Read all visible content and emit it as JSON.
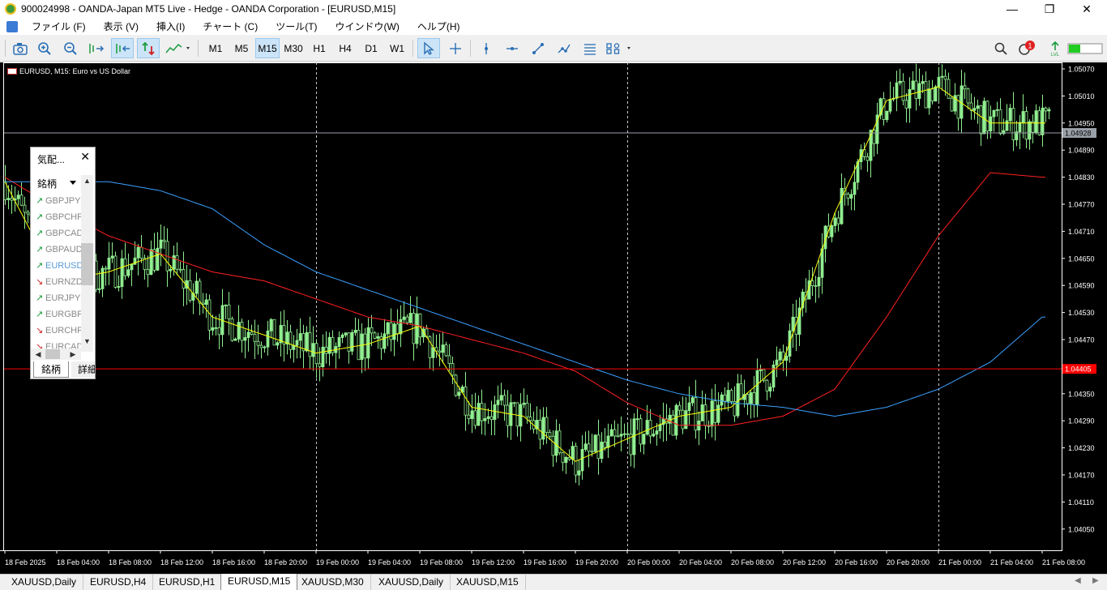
{
  "window": {
    "title": "900024998 - OANDA-Japan MT5 Live - Hedge - OANDA Corporation - [EURUSD,M15]",
    "controls": {
      "minimize": "—",
      "maximize": "❐",
      "close": "✕"
    }
  },
  "menu": [
    "ファイル (F)",
    "表示 (V)",
    "挿入(I)",
    "チャート (C)",
    "ツール(T)",
    "ウインドウ(W)",
    "ヘルプ(H)"
  ],
  "toolbar": {
    "timeframes": [
      "M1",
      "M5",
      "M15",
      "M30",
      "H1",
      "H4",
      "D1",
      "W1"
    ],
    "active_timeframe": "M15",
    "notification_count": "1"
  },
  "chart": {
    "label": "EURUSD, M15:  Euro vs US Dollar",
    "price_labels": [
      "1.05070",
      "1.05010",
      "1.04950",
      "1.04890",
      "1.04830",
      "1.04770",
      "1.04710",
      "1.04650",
      "1.04590",
      "1.04530",
      "1.04470",
      "1.04350",
      "1.04290",
      "1.04230",
      "1.04170",
      "1.04110",
      "1.04050"
    ],
    "bid_price": "1.04928",
    "red_line_price": "1.04405",
    "time_labels": [
      "18 Feb 2025",
      "18 Feb 04:00",
      "18 Feb 08:00",
      "18 Feb 12:00",
      "18 Feb 16:00",
      "18 Feb 20:00",
      "19 Feb 00:00",
      "19 Feb 04:00",
      "19 Feb 08:00",
      "19 Feb 12:00",
      "19 Feb 16:00",
      "19 Feb 20:00",
      "20 Feb 00:00",
      "20 Feb 04:00",
      "20 Feb 08:00",
      "20 Feb 12:00",
      "20 Feb 16:00",
      "20 Feb 20:00",
      "21 Feb 00:00",
      "21 Feb 04:00",
      "21 Feb 08:00"
    ],
    "colors": {
      "background": "#000000",
      "candle": "#90ee90",
      "ma_fast": "#ffff00",
      "ma_mid": "#ff2020",
      "ma_slow": "#3aa0ff",
      "price_line": "#9aa0a8",
      "red_line": "#ff0000"
    }
  },
  "chart_data": {
    "type": "line",
    "symbol": "EURUSD",
    "timeframe": "M15",
    "x": [
      "18 Feb 2025",
      "18 Feb 04:00",
      "18 Feb 08:00",
      "18 Feb 12:00",
      "18 Feb 16:00",
      "18 Feb 20:00",
      "19 Feb 00:00",
      "19 Feb 04:00",
      "19 Feb 08:00",
      "19 Feb 12:00",
      "19 Feb 16:00",
      "19 Feb 20:00",
      "20 Feb 00:00",
      "20 Feb 04:00",
      "20 Feb 08:00",
      "20 Feb 12:00",
      "20 Feb 16:00",
      "20 Feb 20:00",
      "21 Feb 00:00",
      "21 Feb 04:00",
      "21 Feb 08:00"
    ],
    "series": [
      {
        "values": [
          1.0482,
          1.046,
          1.0462,
          1.0466,
          1.0452,
          1.0448,
          1.0444,
          1.0446,
          1.045,
          1.0432,
          1.043,
          1.042,
          1.0425,
          1.043,
          1.0432,
          1.0442,
          1.0475,
          1.05,
          1.0503,
          1.0495,
          1.0495
        ]
      },
      {
        "values": [
          1.0483,
          1.0476,
          1.047,
          1.0466,
          1.0462,
          1.046,
          1.0456,
          1.0452,
          1.045,
          1.0447,
          1.0444,
          1.044,
          1.0433,
          1.0428,
          1.0428,
          1.043,
          1.0436,
          1.0452,
          1.047,
          1.0484,
          1.0483
        ]
      },
      {
        "values": [
          1.0482,
          1.0482,
          1.0482,
          1.048,
          1.0476,
          1.0468,
          1.0462,
          1.0458,
          1.0454,
          1.045,
          1.0446,
          1.0442,
          1.0438,
          1.0435,
          1.0433,
          1.0432,
          1.043,
          1.0432,
          1.0436,
          1.0442,
          1.0452
        ]
      }
    ],
    "ylim": [
      1.0401,
      1.051
    ],
    "yticks": [
      1.0507,
      1.0501,
      1.0495,
      1.0489,
      1.0483,
      1.0477,
      1.0471,
      1.0465,
      1.0459,
      1.0453,
      1.0447,
      1.0435,
      1.0429,
      1.0423,
      1.0417,
      1.0411,
      1.0405
    ],
    "current_bid": 1.04928,
    "marked_level": 1.04405,
    "grid": false
  },
  "market_watch": {
    "title": "気配...",
    "close": "✕",
    "column_header": "銘柄",
    "rows": [
      {
        "symbol": "GBPJPY",
        "dir": "up"
      },
      {
        "symbol": "GBPCHF",
        "dir": "up"
      },
      {
        "symbol": "GBPCAD",
        "dir": "up"
      },
      {
        "symbol": "GBPAUD",
        "dir": "up"
      },
      {
        "symbol": "EURUSD",
        "dir": "up",
        "selected": true
      },
      {
        "symbol": "EURNZD",
        "dir": "down"
      },
      {
        "symbol": "EURJPY",
        "dir": "up"
      },
      {
        "symbol": "EURGBP",
        "dir": "up"
      },
      {
        "symbol": "EURCHF",
        "dir": "down"
      },
      {
        "symbol": "EURCAD",
        "dir": "down"
      }
    ],
    "tabs": [
      "銘柄",
      "詳細"
    ]
  },
  "bottom_tabs": [
    "XAUUSD,Daily",
    "EURUSD,H4",
    "EURUSD,H1",
    "EURUSD,M15",
    "XAUUSD,M30",
    "XAUUSD,Daily",
    "XAUUSD,M15"
  ],
  "active_bottom_tab": "EURUSD,M15"
}
